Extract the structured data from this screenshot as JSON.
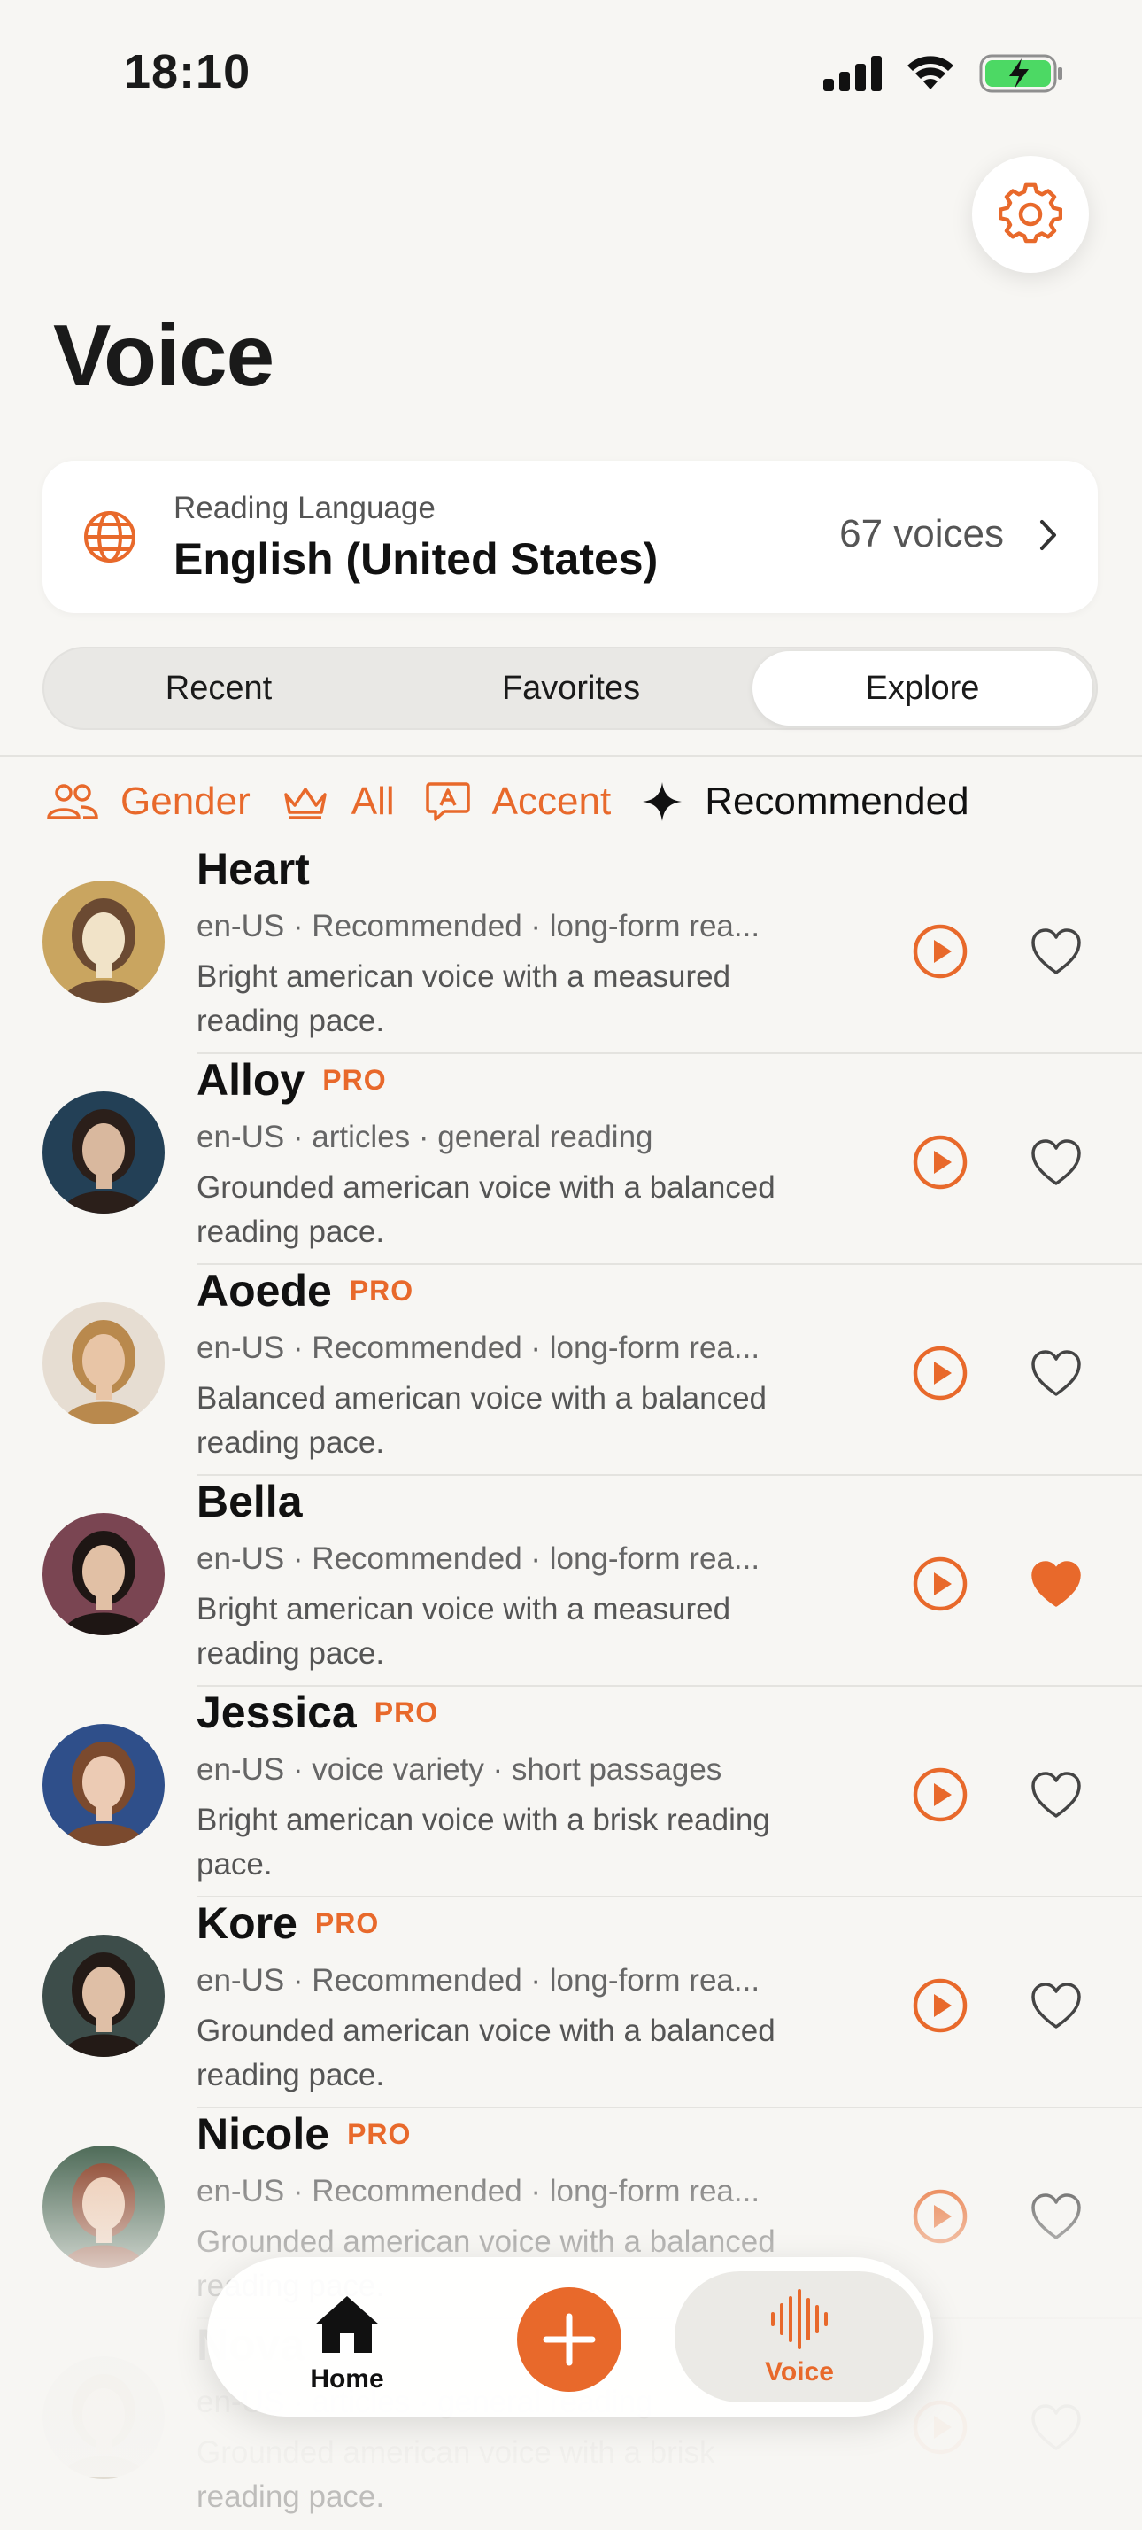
{
  "status_bar": {
    "time": "18:10"
  },
  "header": {
    "title": "Voice",
    "settings_icon": "gear-icon"
  },
  "reading_language": {
    "label": "Reading Language",
    "value": "English (United States)",
    "count": "67 voices"
  },
  "tabs": [
    {
      "label": "Recent",
      "active": false
    },
    {
      "label": "Favorites",
      "active": false
    },
    {
      "label": "Explore",
      "active": true
    }
  ],
  "filters": [
    {
      "label": "Gender",
      "icon": "people-icon"
    },
    {
      "label": "All",
      "icon": "crown-icon"
    },
    {
      "label": "Accent",
      "icon": "speech-bubble-icon"
    },
    {
      "label": "Recommended",
      "icon": "sparkle-icon"
    }
  ],
  "voices": [
    {
      "name": "Heart",
      "pro": "",
      "tags": "en-US · Recommended · long-form rea...",
      "desc": "Bright american voice with a measured reading pace.",
      "favorite": false
    },
    {
      "name": "Alloy",
      "pro": "PRO",
      "tags": "en-US · articles · general reading",
      "desc": "Grounded american voice with a balanced reading pace.",
      "favorite": false
    },
    {
      "name": "Aoede",
      "pro": "PRO",
      "tags": "en-US · Recommended · long-form rea...",
      "desc": "Balanced american voice with a balanced reading pace.",
      "favorite": false
    },
    {
      "name": "Bella",
      "pro": "",
      "tags": "en-US · Recommended · long-form rea...",
      "desc": "Bright american voice with a measured reading pace.",
      "favorite": true
    },
    {
      "name": "Jessica",
      "pro": "PRO",
      "tags": "en-US · voice variety · short passages",
      "desc": "Bright american voice with a brisk reading pace.",
      "favorite": false
    },
    {
      "name": "Kore",
      "pro": "PRO",
      "tags": "en-US · Recommended · long-form rea...",
      "desc": "Grounded american voice with a balanced reading pace.",
      "favorite": false
    },
    {
      "name": "Nicole",
      "pro": "PRO",
      "tags": "en-US · Recommended · long-form rea...",
      "desc": "Grounded american voice with a balanced reading pace.",
      "favorite": false
    },
    {
      "name": "Nova",
      "pro": "",
      "tags": "en-US · articles · general reading",
      "desc": "Grounded american voice with a brisk reading pace.",
      "favorite": false
    }
  ],
  "tab_bar": {
    "home_label": "Home",
    "voice_label": "Voice"
  },
  "colors": {
    "accent": "#e8692b",
    "background": "#f7f6f3",
    "card": "#ffffff"
  }
}
